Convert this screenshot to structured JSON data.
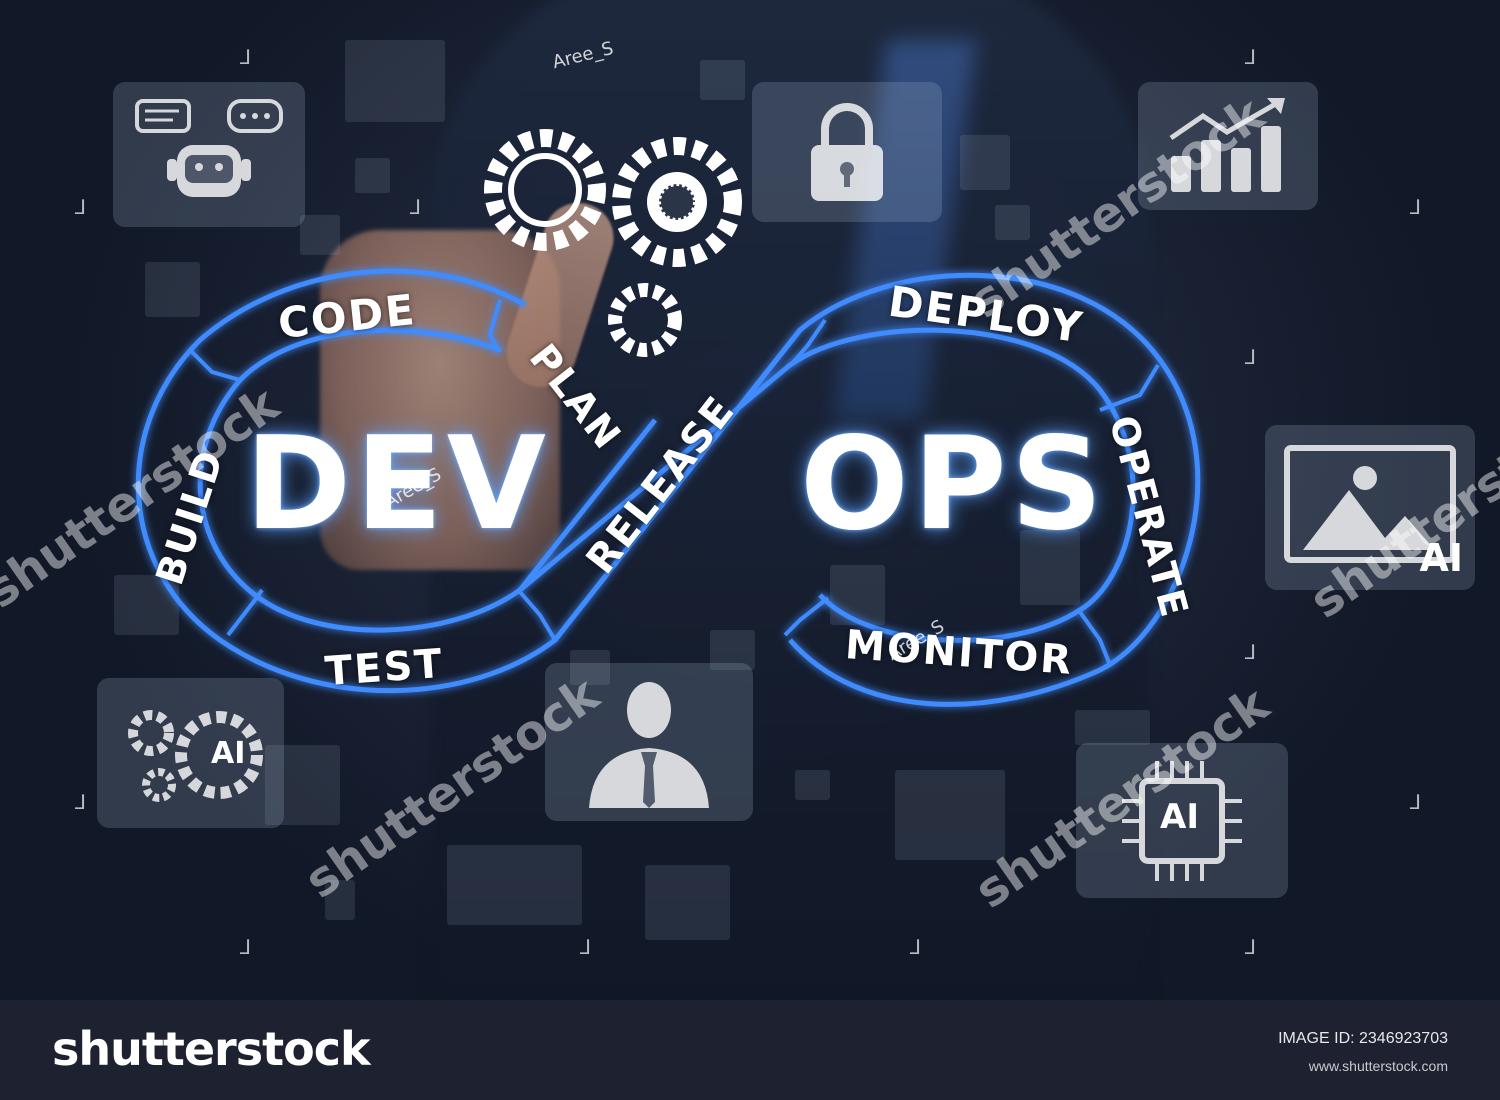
{
  "diagram": {
    "dev_word": "DEV",
    "ops_word": "OPS",
    "stages": {
      "code": "CODE",
      "build": "BUILD",
      "test": "TEST",
      "plan": "PLAN",
      "release": "RELEASE",
      "deploy": "DEPLOY",
      "operate": "OPERATE",
      "monitor": "MONITOR"
    }
  },
  "tiles": {
    "image_ai_label": "AI",
    "gear_ai_label": "AI",
    "chip_ai_label": "AI"
  },
  "overlay": {
    "author_tag": "Aree_S",
    "watermark": "shutterstock"
  },
  "footer": {
    "brand": "shutterstock",
    "image_id": "IMAGE ID: 2346923703",
    "site": "www.shutterstock.com"
  },
  "colors": {
    "ring_glow": "#3f8cff",
    "footer_bg": "#1e2130"
  }
}
